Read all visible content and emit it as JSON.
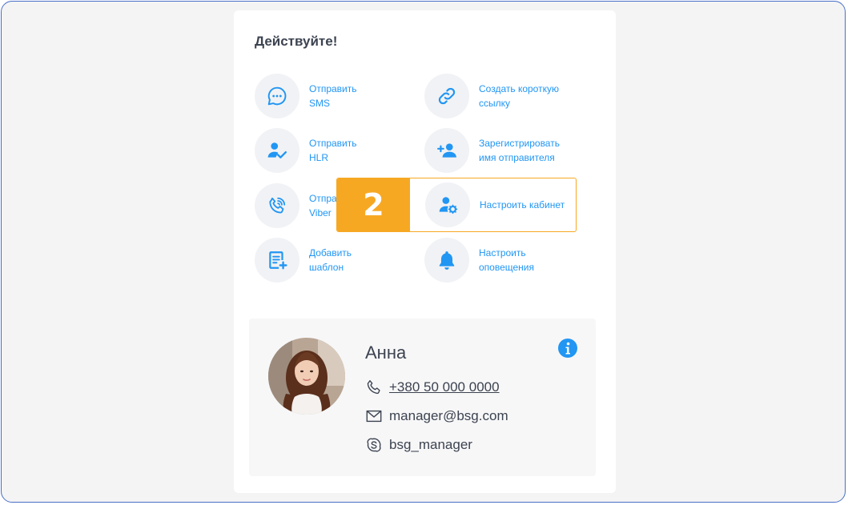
{
  "section_title": "Действуйте!",
  "actions": [
    {
      "label": "Отправить\nSMS",
      "icon": "chat-bubble-icon"
    },
    {
      "label": "Создать короткую\nссылку",
      "icon": "link-icon"
    },
    {
      "label": "Отправить\nHLR",
      "icon": "user-check-icon"
    },
    {
      "label": "Зарегистрировать\nимя отправителя",
      "icon": "user-add-icon"
    },
    {
      "label": "Отправить\nViber",
      "icon": "viber-phone-icon"
    },
    {
      "label": "Настроить кабинет",
      "icon": "user-settings-icon"
    },
    {
      "label": "Добавить\nшаблон",
      "icon": "template-add-icon"
    },
    {
      "label": "Настроить\nоповещения",
      "icon": "bell-icon"
    }
  ],
  "step_badge": "2",
  "manager": {
    "name": "Анна",
    "phone": "+380 50 000 0000",
    "email": "manager@bsg.com",
    "skype": "bsg_manager"
  },
  "colors": {
    "accent": "#2196f3",
    "highlight": "#f7a823",
    "text": "#3c4350"
  }
}
